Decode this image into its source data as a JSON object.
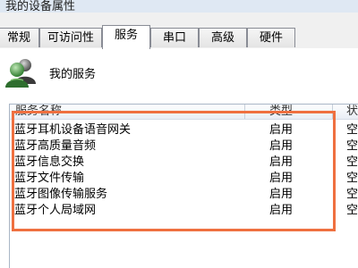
{
  "window": {
    "title": "我的设备属性"
  },
  "tabs": [
    {
      "label": "常规"
    },
    {
      "label": "可访问性"
    },
    {
      "label": "服务"
    },
    {
      "label": "串口"
    },
    {
      "label": "高级"
    },
    {
      "label": "硬件"
    }
  ],
  "selected_tab": "服务",
  "section": {
    "title": "我的服务",
    "icon": "users-icon"
  },
  "list": {
    "columns": [
      "服务名称",
      "类型",
      "状"
    ],
    "rows": [
      {
        "name": "蓝牙耳机设备语音网关",
        "type": "启用",
        "status": "空"
      },
      {
        "name": "蓝牙高质量音频",
        "type": "启用",
        "status": "空"
      },
      {
        "name": "蓝牙信息交换",
        "type": "启用",
        "status": "空"
      },
      {
        "name": "蓝牙文件传输",
        "type": "启用",
        "status": "空"
      },
      {
        "name": "蓝牙图像传输服务",
        "type": "启用",
        "status": "空"
      },
      {
        "name": "蓝牙个人局域网",
        "type": "启用",
        "status": "空"
      }
    ]
  },
  "colors": {
    "highlight": "#ef7040",
    "tab_border": "#898c95",
    "list_border": "#a9b6c6"
  }
}
